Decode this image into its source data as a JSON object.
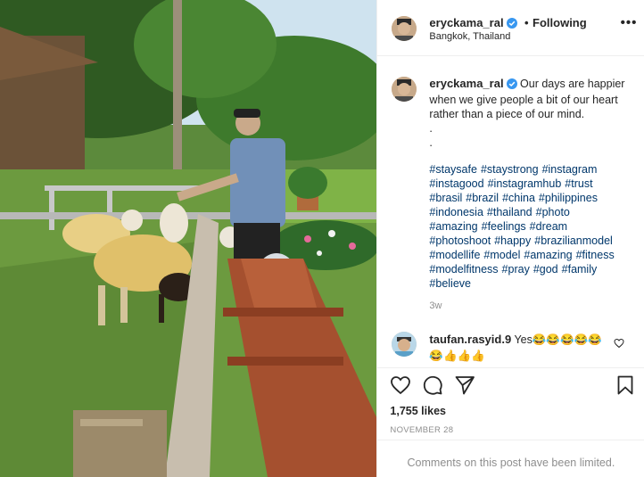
{
  "post": {
    "username": "eryckama_ral",
    "follow_separator": "•",
    "follow_status": "Following",
    "location": "Bangkok, Thailand",
    "more_label": "•••",
    "caption_text": "Our days are happier when we give people a bit of our heart rather than a piece of our mind.",
    "caption_dots": [
      ".",
      "."
    ],
    "hashtags": [
      "#staysafe",
      "#staystrong",
      "#instagram",
      "#instagood",
      "#instagramhub",
      "#trust",
      "#brasil",
      "#brazil",
      "#china",
      "#philippines",
      "#indonesia",
      "#thailand",
      "#photo",
      "#amazing",
      "#feelings",
      "#dream",
      "#photoshoot",
      "#happy",
      "#brazilianmodel",
      "#modellife",
      "#model",
      "#amazing",
      "#fitness",
      "#modelfitness",
      "#pray",
      "#god",
      "#family",
      "#believe"
    ],
    "age": "3w",
    "comment": {
      "username": "taufan.rasyid.9",
      "text": "Yes😂😂😂😂😂😂👍👍👍"
    },
    "likes": "1,755 likes",
    "date": "NOVEMBER 28",
    "comments_limited": "Comments on this post have been limited."
  },
  "icons": {
    "verified": "verified-badge-icon",
    "like": "heart-icon",
    "comment": "comment-icon",
    "share": "paper-plane-icon",
    "save": "bookmark-icon"
  },
  "colors": {
    "verified_blue": "#3897f0",
    "hashtag_blue": "#00376b",
    "muted_gray": "#8e8e8e"
  }
}
